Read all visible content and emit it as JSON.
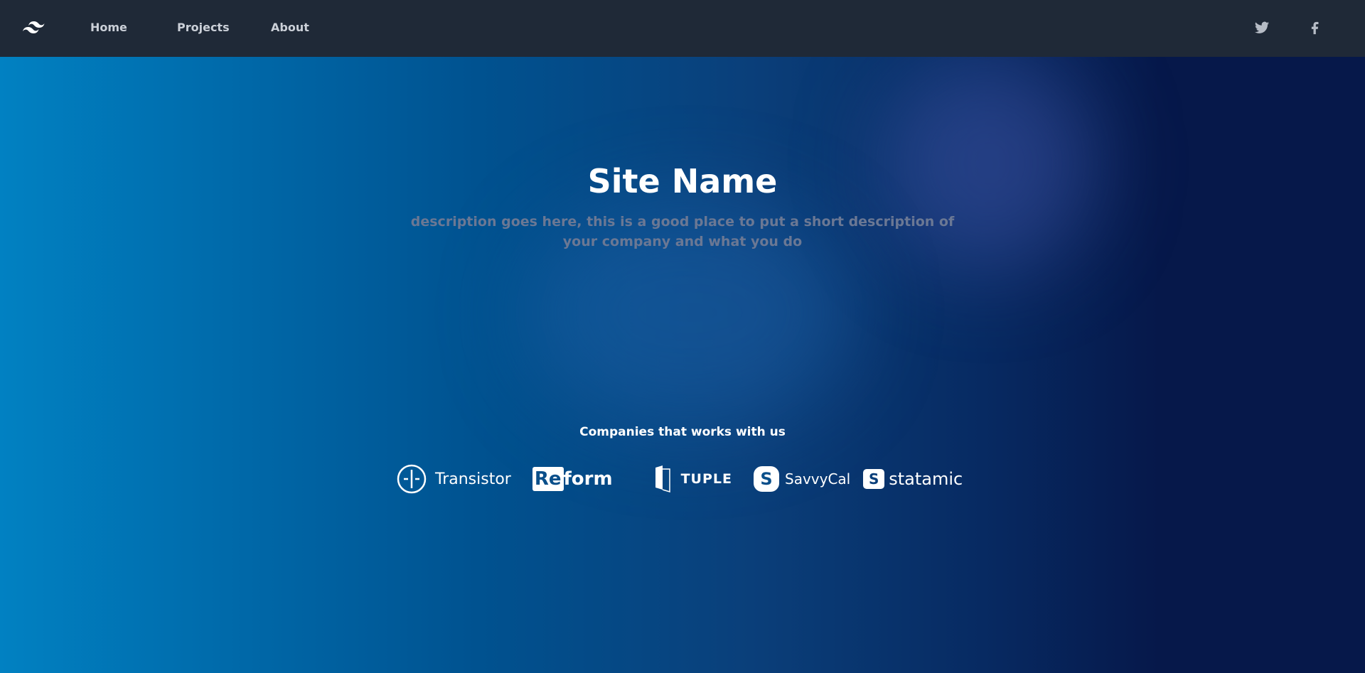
{
  "nav": {
    "home": "Home",
    "projects": "Projects",
    "about": "About",
    "logo_icon": "tailwind-wave-icon",
    "social": [
      "twitter-icon",
      "facebook-icon"
    ]
  },
  "hero": {
    "title": "Site Name",
    "description": "description goes here, this is a good place to put a short description of your company and what you do"
  },
  "companies": {
    "heading": "Companies that works with us",
    "logos": [
      "Transistor",
      "Reform",
      "TUPLE",
      "SavvyCal",
      "statamic"
    ]
  },
  "colors": {
    "nav_bg": "#1f2937",
    "gradient_left": "#0181c2",
    "gradient_right": "#06184a"
  }
}
